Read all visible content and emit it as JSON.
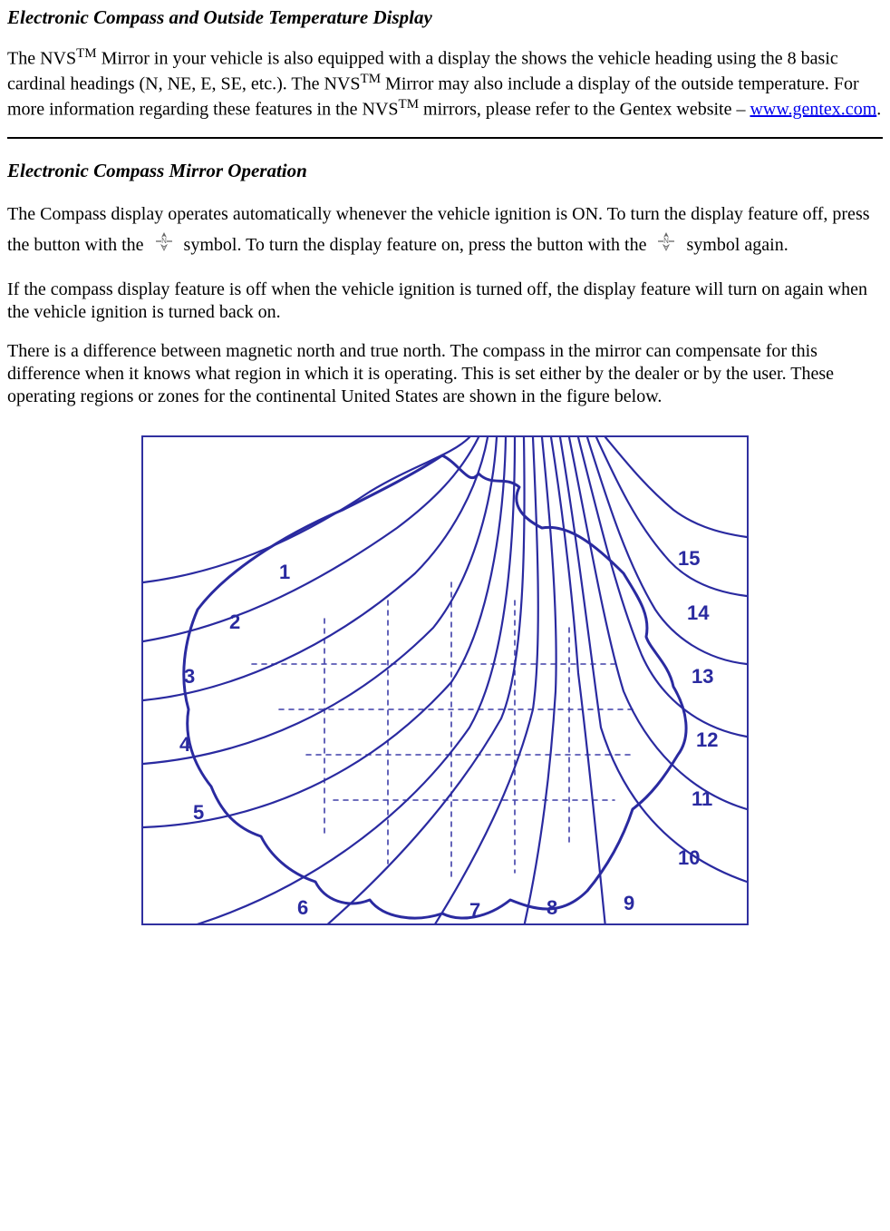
{
  "section1": {
    "heading": "Electronic Compass and Outside Temperature Display",
    "p1_a": "The NVS",
    "tm": "TM",
    "p1_b": " Mirror in your vehicle is also equipped with a display the shows the vehicle heading using the 8 basic cardinal headings (N, NE, E, SE, etc.).  The NVS",
    "p1_c": " Mirror may also include a display of the outside temperature.  For more information regarding these features in the NVS",
    "p1_d": " mirrors, please refer to the Gentex website – ",
    "link_text": "www.gentex.com",
    "p1_e": "."
  },
  "section2": {
    "heading": "Electronic Compass Mirror Operation",
    "p1_a": "The Compass display operates automatically whenever the vehicle ignition is ON.  To turn the display feature off, press the button with the ",
    "p1_b": " symbol.  To turn the display feature on, press the button with the ",
    "p1_c": " symbol again.",
    "p2": "If the compass display feature is off when the vehicle ignition is turned off, the display feature will turn on again when the vehicle ignition is turned back on.",
    "p3": "There is a difference between magnetic north and true north.  The compass in the mirror can compensate for this difference when it knows what region in which it is operating.  This is set either by the dealer or by the user.  These operating regions or zones for the continental United States are shown in the figure below."
  },
  "compass_icon_name": "compass-north-icon",
  "zones": {
    "z1": "1",
    "z2": "2",
    "z3": "3",
    "z4": "4",
    "z5": "5",
    "z6": "6",
    "z7": "7",
    "z8": "8",
    "z9": "9",
    "z10": "10",
    "z11": "11",
    "z12": "12",
    "z13": "13",
    "z14": "14",
    "z15": "15"
  }
}
